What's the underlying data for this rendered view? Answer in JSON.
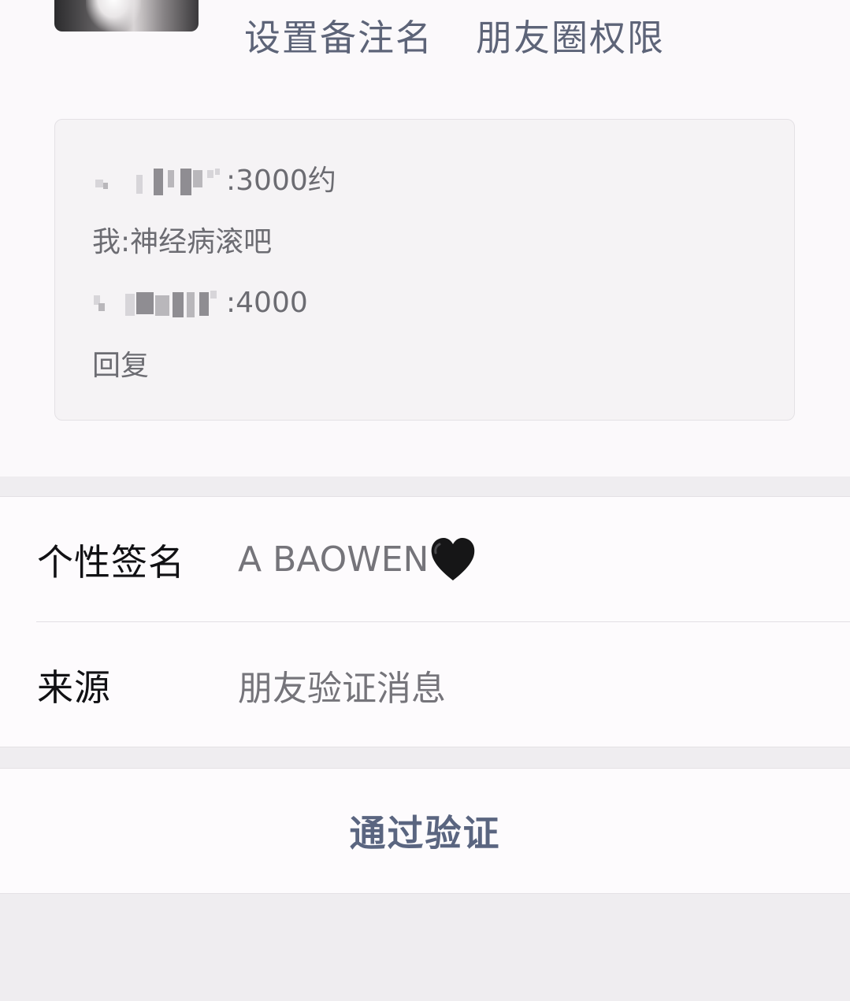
{
  "header": {
    "actions": [
      {
        "label": "设置备注名"
      },
      {
        "label": "朋友圈权限"
      }
    ]
  },
  "message_box": {
    "lines": [
      {
        "sender": "",
        "separator": ": ",
        "text": "3000约"
      },
      {
        "sender": "我",
        "separator": ": ",
        "text": "神经病滚吧"
      },
      {
        "sender": "",
        "separator": ": ",
        "text": "4000"
      }
    ],
    "reply_label": "回复"
  },
  "profile": {
    "signature_label": "个性签名",
    "signature_value": "A  BAOWEN",
    "source_label": "来源",
    "source_value": "朋友验证消息"
  },
  "action": {
    "verify_label": "通过验证"
  },
  "colors": {
    "link_text": "#5d6478",
    "muted_text": "#75747a",
    "background": "#efedf0"
  },
  "icons": {
    "signature_emoji": "black-heart-icon"
  }
}
